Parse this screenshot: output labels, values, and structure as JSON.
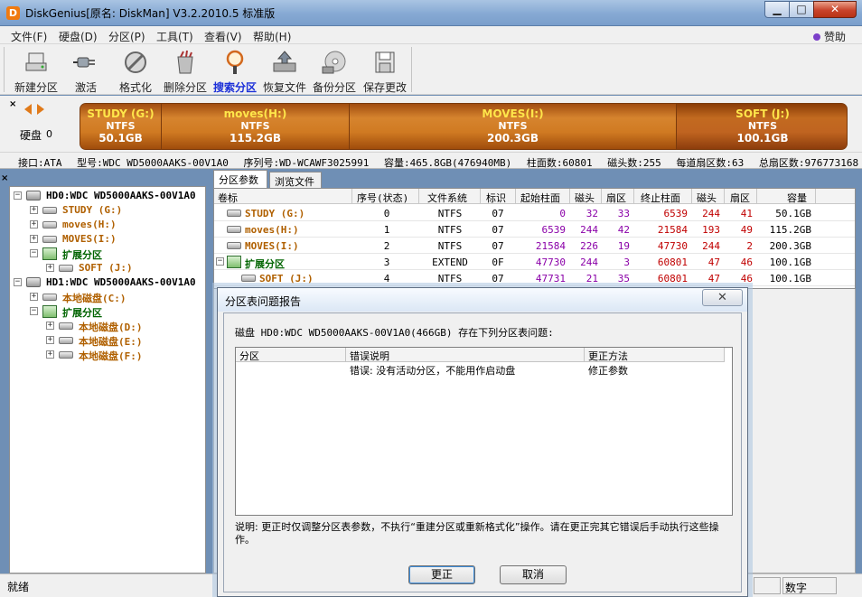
{
  "window": {
    "title": "DiskGenius[原名: DiskMan] V3.2.2010.5 标准版",
    "app_icon_letter": "D",
    "min_glyph": "▁",
    "max_glyph": "□",
    "close_glyph": "✕"
  },
  "menu": {
    "items": [
      "文件(F)",
      "硬盘(D)",
      "分区(P)",
      "工具(T)",
      "查看(V)",
      "帮助(H)"
    ],
    "sponsor": "赞助"
  },
  "toolbar": {
    "buttons": [
      {
        "label": "新建分区",
        "icon": "new-partition-icon"
      },
      {
        "label": "激活",
        "icon": "plug-icon"
      },
      {
        "label": "格式化",
        "icon": "format-icon"
      },
      {
        "label": "删除分区",
        "icon": "trash-icon"
      },
      {
        "label": "搜索分区",
        "icon": "magnifier-icon",
        "active": true
      },
      {
        "label": "恢复文件",
        "icon": "recover-file-icon"
      },
      {
        "label": "备份分区",
        "icon": "backup-disc-icon"
      },
      {
        "label": "保存更改",
        "icon": "save-icon"
      }
    ]
  },
  "disk_panel": {
    "close_glyph": "×",
    "disk_label": "硬盘",
    "disk_number": "0",
    "segments": [
      {
        "name": "STUDY (G:)",
        "fs": "NTFS",
        "size": "50.1GB"
      },
      {
        "name": "moves(H:)",
        "fs": "NTFS",
        "size": "115.2GB"
      },
      {
        "name": "MOVES(I:)",
        "fs": "NTFS",
        "size": "200.3GB"
      },
      {
        "name": "SOFT  (J:)",
        "fs": "NTFS",
        "size": "100.1GB"
      }
    ],
    "info": {
      "interface": "接口:ATA",
      "model": "型号:WDC WD5000AAKS-00V1A0",
      "serial": "序列号:WD-WCAWF3025991",
      "capacity": "容量:465.8GB(476940MB)",
      "cylinders": "柱面数:60801",
      "heads": "磁头数:255",
      "sectors_per_track": "每道扇区数:63",
      "total_sectors": "总扇区数:976773168"
    }
  },
  "tree": {
    "close_glyph": "×",
    "nodes": [
      {
        "label": "HD0:WDC WD5000AAKS-00V1A0",
        "kind": "disk"
      },
      {
        "label": "STUDY (G:)",
        "kind": "part"
      },
      {
        "label": "moves(H:)",
        "kind": "part"
      },
      {
        "label": "MOVES(I:)",
        "kind": "part"
      },
      {
        "label": "扩展分区",
        "kind": "ext"
      },
      {
        "label": "SOFT      (J:)",
        "kind": "part"
      },
      {
        "label": "HD1:WDC WD5000AAKS-00V1A0",
        "kind": "disk"
      },
      {
        "label": "本地磁盘(C:)",
        "kind": "part"
      },
      {
        "label": "扩展分区",
        "kind": "ext"
      },
      {
        "label": "本地磁盘(D:)",
        "kind": "part"
      },
      {
        "label": "本地磁盘(E:)",
        "kind": "part"
      },
      {
        "label": "本地磁盘(F:)",
        "kind": "part"
      }
    ]
  },
  "tabs": [
    "分区参数",
    "浏览文件"
  ],
  "grid": {
    "columns": [
      "卷标",
      "序号(状态)",
      "文件系统",
      "标识",
      "起始柱面",
      "磁头",
      "扇区",
      "终止柱面",
      "磁头",
      "扇区",
      "容量"
    ],
    "rows": [
      {
        "label": "STUDY (G:)",
        "index": "0",
        "fs": "NTFS",
        "id": "07",
        "start_cyl": "0",
        "start_head": "32",
        "start_sec": "33",
        "end_cyl": "6539",
        "end_head": "244",
        "end_sec": "41",
        "size": "50.1GB"
      },
      {
        "label": "moves(H:)",
        "index": "1",
        "fs": "NTFS",
        "id": "07",
        "start_cyl": "6539",
        "start_head": "244",
        "start_sec": "42",
        "end_cyl": "21584",
        "end_head": "193",
        "end_sec": "49",
        "size": "115.2GB"
      },
      {
        "label": "MOVES(I:)",
        "index": "2",
        "fs": "NTFS",
        "id": "07",
        "start_cyl": "21584",
        "start_head": "226",
        "start_sec": "19",
        "end_cyl": "47730",
        "end_head": "244",
        "end_sec": "2",
        "size": "200.3GB"
      },
      {
        "label": "扩展分区",
        "index": "3",
        "fs": "EXTEND",
        "id": "0F",
        "start_cyl": "47730",
        "start_head": "244",
        "start_sec": "3",
        "end_cyl": "60801",
        "end_head": "47",
        "end_sec": "46",
        "size": "100.1GB"
      },
      {
        "label": "SOFT      (J:)",
        "index": "4",
        "fs": "NTFS",
        "id": "07",
        "start_cyl": "47731",
        "start_head": "21",
        "start_sec": "35",
        "end_cyl": "60801",
        "end_head": "47",
        "end_sec": "46",
        "size": "100.1GB"
      }
    ]
  },
  "status": {
    "text": "就绪",
    "num_lock": "数字"
  },
  "dialog": {
    "title": "分区表问题报告",
    "close_glyph": "✕",
    "message": "磁盘 HD0:WDC WD5000AAKS-00V1A0(466GB) 存在下列分区表问题:",
    "list_columns": [
      "分区",
      "错误说明",
      "更正方法"
    ],
    "list_rows": [
      {
        "partition": "",
        "error": "错误: 没有活动分区，不能用作启动盘",
        "fix": "修正参数"
      }
    ],
    "note": "说明: 更正时仅调整分区表参数，不执行“重建分区或重新格式化”操作。请在更正完其它错误后手动执行这些操作。",
    "ok_label": "更正",
    "cancel_label": "取消"
  }
}
